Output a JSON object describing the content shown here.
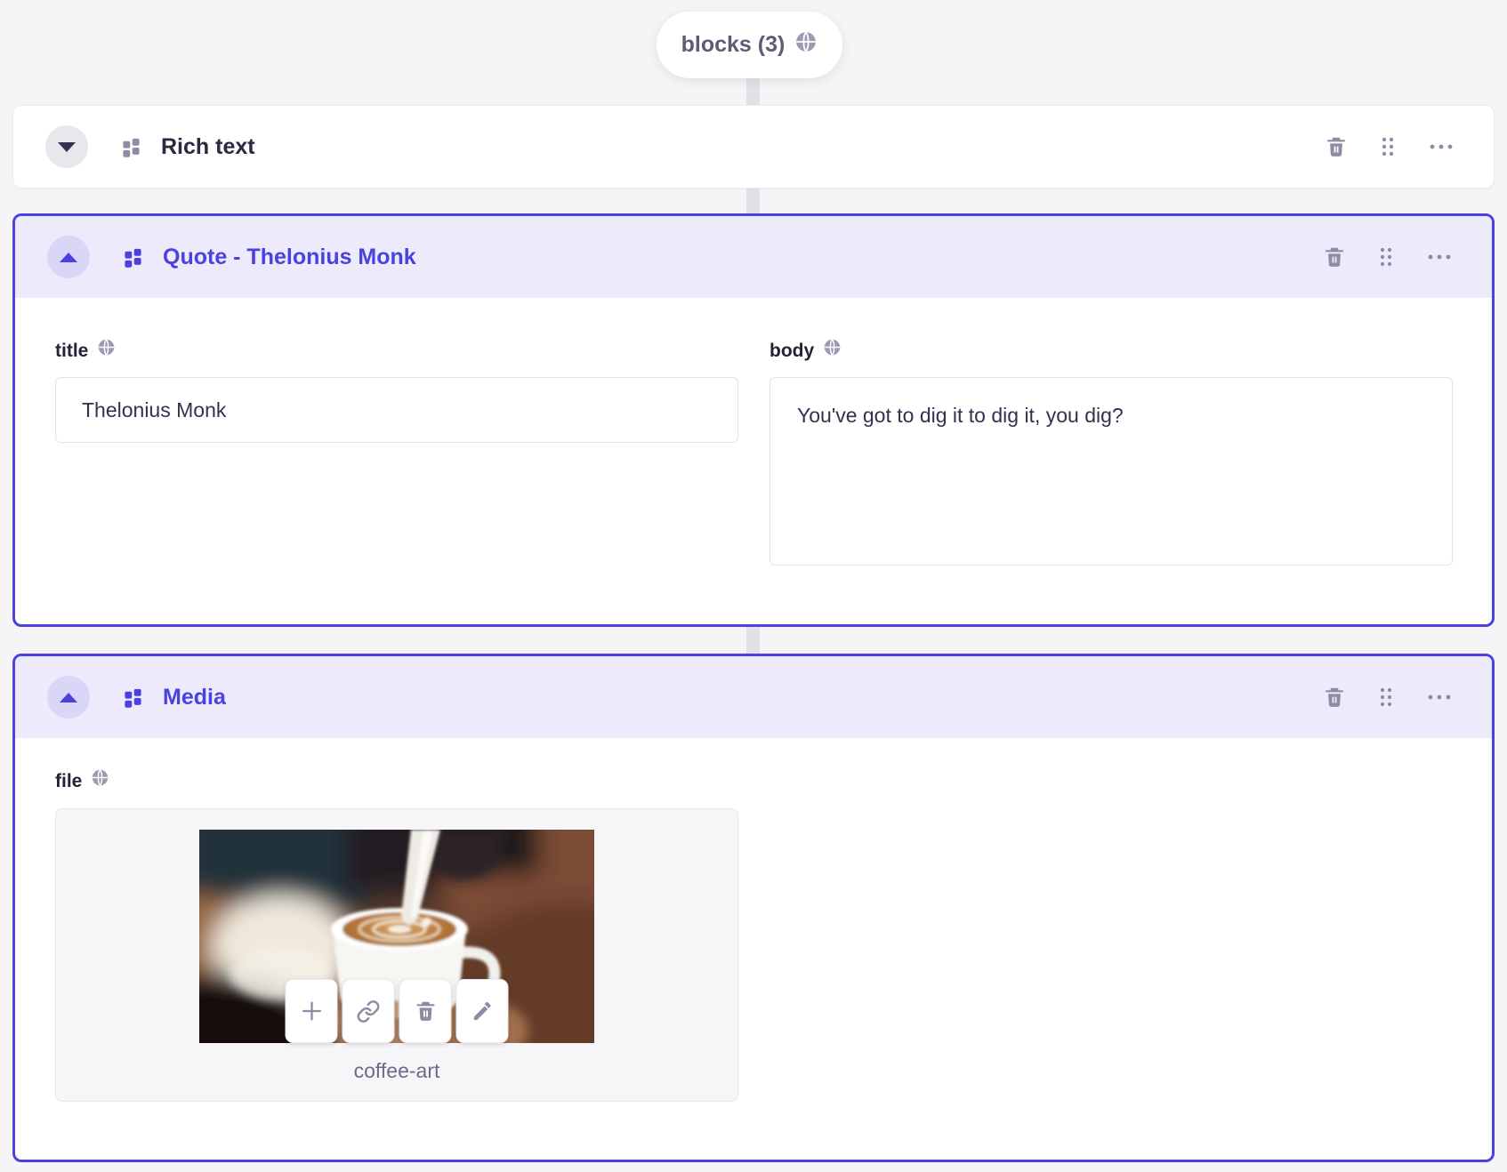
{
  "header_pill": {
    "label": "blocks (3)"
  },
  "colors": {
    "accent": "#4B41E1",
    "accent_soft_bg": "#ECEAFB",
    "icon_gray": "#8C8CA4",
    "page_bg": "#F5F5F7"
  },
  "icons": {
    "globe-icon": "globe (localized field indicator)",
    "collapse-chevron-down-icon": "triangle pointing down",
    "collapse-chevron-up-icon": "triangle pointing up",
    "blocks-grid-icon": "2x2 squares block type glyph",
    "trash-icon": "trash can",
    "drag-handle-icon": "six dots drag grip",
    "ellipsis-icon": "three dots more menu",
    "plus-icon": "plus",
    "link-icon": "chain link",
    "pencil-icon": "pencil / edit"
  },
  "blocks": [
    {
      "title": "Rich text",
      "collapsed": true
    },
    {
      "title": "Quote - Thelonius Monk",
      "collapsed": false,
      "fields": {
        "title": {
          "label": "title",
          "value": "Thelonius Monk"
        },
        "body": {
          "label": "body",
          "value": "You've got to dig it to dig it, you dig?"
        }
      }
    },
    {
      "title": "Media",
      "collapsed": false,
      "fields": {
        "file": {
          "label": "file",
          "filename": "coffee-art"
        }
      }
    }
  ]
}
